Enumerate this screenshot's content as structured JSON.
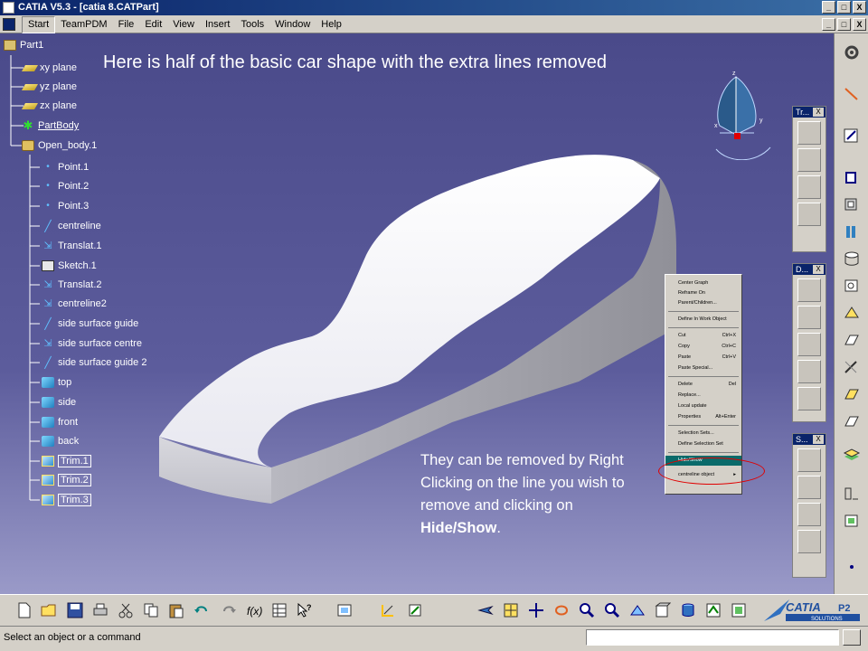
{
  "window": {
    "title": "CATIA V5.3 - [catia 8.CATPart]",
    "controls": [
      "_",
      "□",
      "X"
    ]
  },
  "menu": {
    "items": [
      "Start",
      "TeamPDM",
      "File",
      "Edit",
      "View",
      "Insert",
      "Tools",
      "Window",
      "Help"
    ]
  },
  "tree": {
    "root": "Part1",
    "items": [
      {
        "label": "xy plane",
        "icon": "plane-icon"
      },
      {
        "label": "yz plane",
        "icon": "plane-icon"
      },
      {
        "label": "zx plane",
        "icon": "plane-icon"
      },
      {
        "label": "PartBody",
        "icon": "partbody-icon"
      },
      {
        "label": "Open_body.1",
        "icon": "open-body-icon"
      },
      {
        "label": "Point.1",
        "icon": "point-icon"
      },
      {
        "label": "Point.2",
        "icon": "point-icon"
      },
      {
        "label": "Point.3",
        "icon": "point-icon"
      },
      {
        "label": "centreline",
        "icon": "line-icon"
      },
      {
        "label": "Translat.1",
        "icon": "translate-icon"
      },
      {
        "label": "Sketch.1",
        "icon": "sketch-icon"
      },
      {
        "label": "Translat.2",
        "icon": "translate-icon"
      },
      {
        "label": "centreline2",
        "icon": "translate-icon"
      },
      {
        "label": "side surface guide",
        "icon": "line-icon"
      },
      {
        "label": "side surface centre",
        "icon": "translate-icon"
      },
      {
        "label": "side surface guide 2",
        "icon": "line-icon"
      },
      {
        "label": "top",
        "icon": "surface-icon"
      },
      {
        "label": "side",
        "icon": "surface-icon"
      },
      {
        "label": "front",
        "icon": "surface-icon"
      },
      {
        "label": "back",
        "icon": "surface-icon"
      },
      {
        "label": "Trim.1",
        "icon": "trim-icon"
      },
      {
        "label": "Trim.2",
        "icon": "trim-icon"
      },
      {
        "label": "Trim.3",
        "icon": "trim-icon"
      }
    ]
  },
  "annotations": {
    "heading": "Here is half of the basic car shape with the extra lines removed",
    "note_prefix": "They can be removed by Right Clicking on the line you wish to remove and clicking on ",
    "note_bold": "Hide/Show",
    "note_suffix": "."
  },
  "context_menu": {
    "items": [
      {
        "label": "Center Graph",
        "shortcut": ""
      },
      {
        "label": "Reframe On",
        "shortcut": ""
      },
      {
        "label": "Parent/Children...",
        "shortcut": ""
      },
      {
        "label": "Define In Work Object",
        "shortcut": ""
      },
      {
        "label": "Cut",
        "shortcut": "Ctrl+X"
      },
      {
        "label": "Copy",
        "shortcut": "Ctrl+C"
      },
      {
        "label": "Paste",
        "shortcut": "Ctrl+V"
      },
      {
        "label": "Paste Special...",
        "shortcut": ""
      },
      {
        "label": "Delete",
        "shortcut": "Del"
      },
      {
        "label": "Replace...",
        "shortcut": ""
      },
      {
        "label": "Local update",
        "shortcut": ""
      },
      {
        "label": "Properties",
        "shortcut": "Alt+Enter"
      },
      {
        "label": "Selection Sets...",
        "shortcut": ""
      },
      {
        "label": "Define Selection Set",
        "shortcut": ""
      },
      {
        "label": "Hide/Show",
        "shortcut": ""
      },
      {
        "label": "centreline object",
        "shortcut": "▸"
      }
    ],
    "selected": "Hide/Show"
  },
  "toolbars": {
    "floating": [
      {
        "title": "Tr...",
        "close": "X"
      },
      {
        "title": "D...",
        "close": "X"
      },
      {
        "title": "S...",
        "close": "X"
      }
    ]
  },
  "status": {
    "message": "Select an object or a command",
    "command_value": ""
  },
  "compass": {
    "labels": [
      "z",
      "x",
      "y"
    ]
  },
  "logo": {
    "brand": "CATIA",
    "suffix": "P2",
    "tagline": "SOLUTIONS"
  },
  "colors": {
    "title_bar": "#0a246a",
    "viewport_top": "#4a4a8a",
    "viewport_bottom": "#9a9ac8",
    "highlight_circle": "#e00000",
    "selected_menu": "#0a6a6a"
  }
}
